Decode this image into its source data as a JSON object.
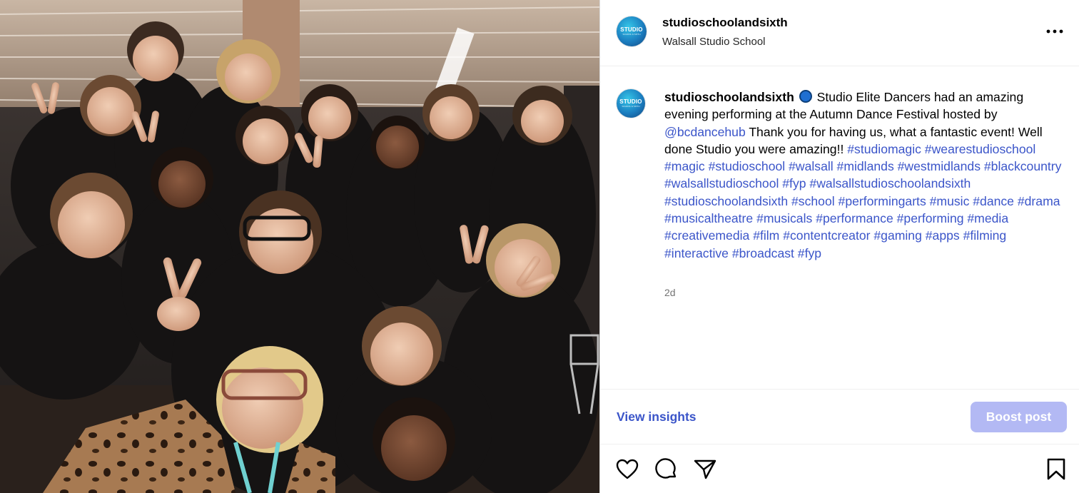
{
  "post": {
    "username": "studioschoolandsixth",
    "location": "Walsall Studio School",
    "avatar_logo": {
      "main": "STUDIO",
      "sub": "SCHOOL & SIXTH"
    },
    "caption": {
      "username": "studioschoolandsixth",
      "text": "Studio Elite Dancers had an amazing evening performing at the Autumn Dance Festival hosted by",
      "mention": "@bcdancehub",
      "text2": "Thank you for having us, what a fantastic event! Well done Studio you were amazing!!",
      "hashtags": "#studiomagic #wearestudioschool #magic #studioschool #walsall #midlands #westmidlands #blackcountry #walsallstudioschool #fyp #walsallstudioschoolandsixth #studioschoolandsixth #school #performingarts #music #dance #drama #musicaltheatre #musicals #performance #performing #media #creativemedia #film #contentcreator #gaming #apps #filming #interactive #broadcast #fyp"
    },
    "time_ago": "2d",
    "view_insights_label": "View insights",
    "boost_label": "Boost post"
  },
  "icons": {
    "more": "more-options-icon",
    "like": "heart-icon",
    "comment": "comment-icon",
    "share": "share-icon",
    "save": "bookmark-icon"
  },
  "colors": {
    "link": "#3b55c9",
    "boost_button": "#b3b9f4",
    "muted_text": "#737373"
  }
}
